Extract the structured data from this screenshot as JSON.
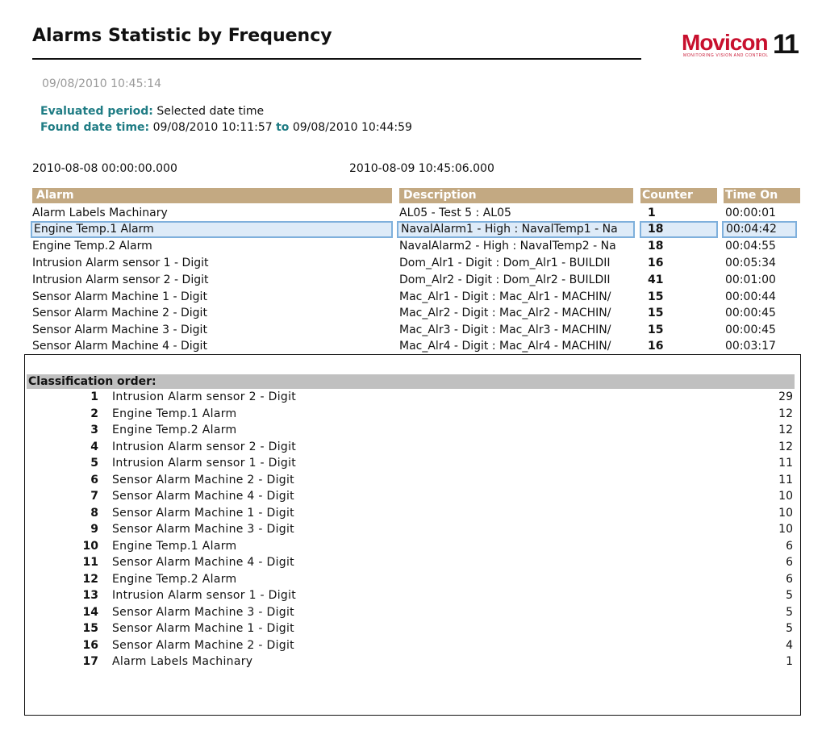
{
  "report": {
    "title": "Alarms Statistic by Frequency",
    "timestamp": "09/08/2010  10:45:14",
    "evaluated_label": "Evaluated period:",
    "evaluated_value": "Selected date time",
    "found_label": "Found date time:",
    "found_from": "09/08/2010  10:11:57",
    "found_to_label": "to",
    "found_to": "09/08/2010  10:44:59",
    "range_start": "2010-08-08 00:00:00.000",
    "range_end": "2010-08-09 10:45:06.000"
  },
  "logo": {
    "text": "Movicon",
    "number": "11",
    "tagline": "MONITORING VISION AND CONTROL",
    "brand_color": "#c8102e"
  },
  "table": {
    "headers": {
      "alarm": "Alarm",
      "description": "Description",
      "counter": "Counter",
      "time_on": "Time On"
    },
    "header_color": "#c3a982",
    "selected_row_index": 1,
    "rows": [
      {
        "alarm": "Alarm Labels Machinary",
        "description": "AL05 - Test 5 : AL05",
        "counter": "1",
        "time_on": "00:00:01"
      },
      {
        "alarm": "Engine Temp.1 Alarm",
        "description": "NavalAlarm1 - High : NavalTemp1 - Na",
        "counter": "18",
        "time_on": "00:04:42"
      },
      {
        "alarm": "Engine Temp.2 Alarm",
        "description": "NavalAlarm2 - High : NavalTemp2 - Na",
        "counter": "18",
        "time_on": "00:04:55"
      },
      {
        "alarm": "Intrusion Alarm sensor 1 - Digit",
        "description": "Dom_Alr1 - Digit : Dom_Alr1 - BUILDII",
        "counter": "16",
        "time_on": "00:05:34"
      },
      {
        "alarm": "Intrusion Alarm sensor 2 - Digit",
        "description": "Dom_Alr2 - Digit : Dom_Alr2 - BUILDII",
        "counter": "41",
        "time_on": "00:01:00"
      },
      {
        "alarm": "Sensor Alarm Machine 1 - Digit",
        "description": "Mac_Alr1 - Digit : Mac_Alr1 - MACHIN/",
        "counter": "15",
        "time_on": "00:00:44"
      },
      {
        "alarm": "Sensor Alarm Machine 2 - Digit",
        "description": "Mac_Alr2 - Digit : Mac_Alr2 - MACHIN/",
        "counter": "15",
        "time_on": "00:00:45"
      },
      {
        "alarm": "Sensor Alarm Machine 3 - Digit",
        "description": "Mac_Alr3 - Digit : Mac_Alr3 - MACHIN/",
        "counter": "15",
        "time_on": "00:00:45"
      },
      {
        "alarm": "Sensor Alarm Machine 4 - Digit",
        "description": "Mac_Alr4 - Digit : Mac_Alr4 - MACHIN/",
        "counter": "16",
        "time_on": "00:03:17"
      }
    ]
  },
  "classification": {
    "title": "Classification order:",
    "items": [
      {
        "rank": "1",
        "name": "Intrusion Alarm sensor 2 - Digit",
        "count": "29"
      },
      {
        "rank": "2",
        "name": "Engine Temp.1 Alarm",
        "count": "12"
      },
      {
        "rank": "3",
        "name": "Engine Temp.2 Alarm",
        "count": "12"
      },
      {
        "rank": "4",
        "name": "Intrusion Alarm sensor 2 - Digit",
        "count": "12"
      },
      {
        "rank": "5",
        "name": "Intrusion Alarm sensor 1 - Digit",
        "count": "11"
      },
      {
        "rank": "6",
        "name": "Sensor Alarm Machine 2 - Digit",
        "count": "11"
      },
      {
        "rank": "7",
        "name": "Sensor Alarm Machine 4 - Digit",
        "count": "10"
      },
      {
        "rank": "8",
        "name": "Sensor Alarm Machine 1 - Digit",
        "count": "10"
      },
      {
        "rank": "9",
        "name": "Sensor Alarm Machine 3 - Digit",
        "count": "10"
      },
      {
        "rank": "10",
        "name": "Engine Temp.1 Alarm",
        "count": "6"
      },
      {
        "rank": "11",
        "name": "Sensor Alarm Machine 4 - Digit",
        "count": "6"
      },
      {
        "rank": "12",
        "name": "Engine Temp.2 Alarm",
        "count": "6"
      },
      {
        "rank": "13",
        "name": "Intrusion Alarm sensor 1 - Digit",
        "count": "5"
      },
      {
        "rank": "14",
        "name": "Sensor Alarm Machine 3 - Digit",
        "count": "5"
      },
      {
        "rank": "15",
        "name": "Sensor Alarm Machine 1 - Digit",
        "count": "5"
      },
      {
        "rank": "16",
        "name": "Sensor Alarm Machine 2 - Digit",
        "count": "4"
      },
      {
        "rank": "17",
        "name": "Alarm Labels Machinary",
        "count": "1"
      }
    ]
  }
}
